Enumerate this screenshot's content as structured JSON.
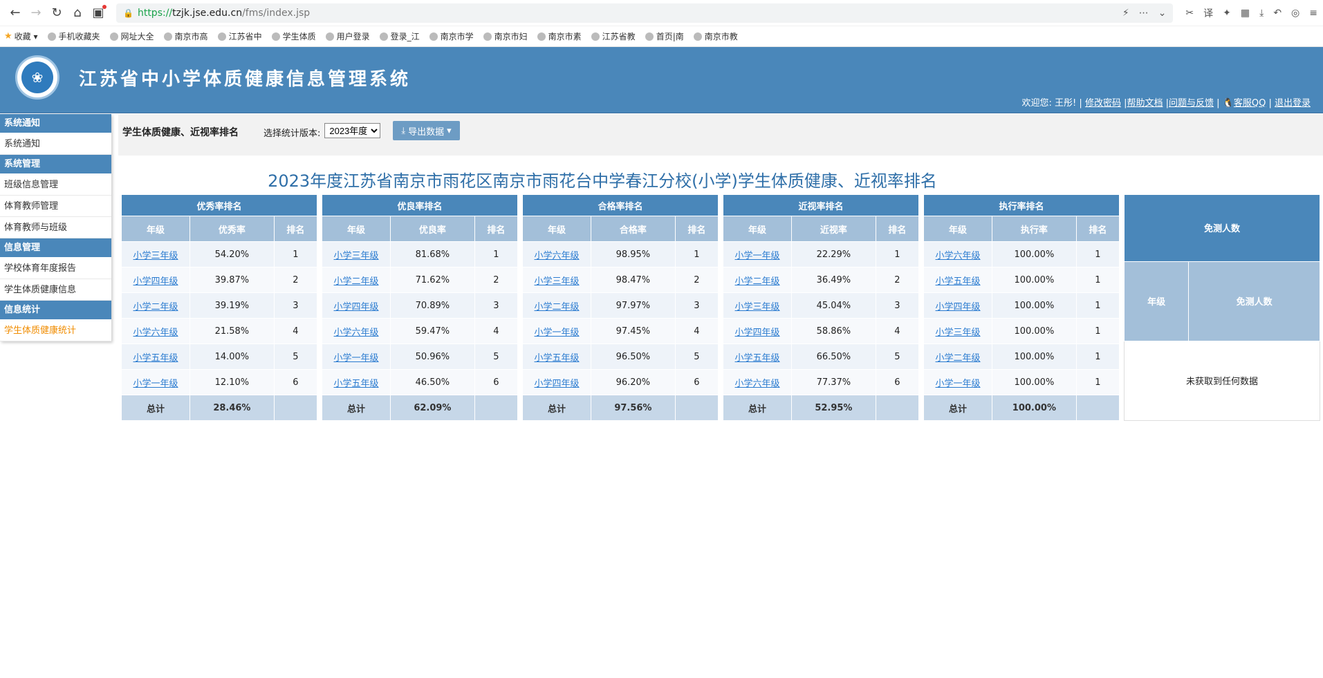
{
  "browser": {
    "url_https": "https://",
    "url_host": "tzjk.jse.edu.cn",
    "url_path": "/fms/index.jsp",
    "bookmarks": [
      "收藏",
      "手机收藏夹",
      "网址大全",
      "南京市高",
      "江苏省中",
      "学生体质",
      "用户登录",
      "登录_江",
      "南京市学",
      "南京市妇",
      "南京市素",
      "江苏省教",
      "首页|南",
      "南京市教"
    ]
  },
  "header": {
    "title": "江苏省中小学体质健康信息管理系统",
    "welcome": "欢迎您: 王彤! |",
    "links": [
      "修改密码",
      "帮助文档",
      "问题与反馈",
      "客服QQ",
      "退出登录"
    ]
  },
  "sidebar": {
    "sec1": "系统通知",
    "item1": "系统通知",
    "sec2": "系统管理",
    "item2": "班级信息管理",
    "item3": "体育教师管理",
    "item4": "体育教师与班级",
    "sec3": "信息管理",
    "item5": "学校体育年度报告",
    "item6": "学生体质健康信息",
    "sec4": "信息统计",
    "item7": "学生体质健康统计"
  },
  "toolbar": {
    "page_label": "学生体质健康、近视率排名",
    "version_label": "选择统计版本:",
    "version_value": "2023年度",
    "export_label": "导出数据"
  },
  "main_title": "2023年度江苏省南京市雨花区南京市雨花台中学春江分校(小学)学生体质健康、近视率排名",
  "col_grade": "年级",
  "col_rank": "排名",
  "total_label": "总计",
  "tables": [
    {
      "title": "优秀率排名",
      "metric": "优秀率",
      "rows": [
        [
          "小学三年级",
          "54.20%",
          "1"
        ],
        [
          "小学四年级",
          "39.87%",
          "2"
        ],
        [
          "小学二年级",
          "39.19%",
          "3"
        ],
        [
          "小学六年级",
          "21.58%",
          "4"
        ],
        [
          "小学五年级",
          "14.00%",
          "5"
        ],
        [
          "小学一年级",
          "12.10%",
          "6"
        ]
      ],
      "total": "28.46%"
    },
    {
      "title": "优良率排名",
      "metric": "优良率",
      "rows": [
        [
          "小学三年级",
          "81.68%",
          "1"
        ],
        [
          "小学二年级",
          "71.62%",
          "2"
        ],
        [
          "小学四年级",
          "70.89%",
          "3"
        ],
        [
          "小学六年级",
          "59.47%",
          "4"
        ],
        [
          "小学一年级",
          "50.96%",
          "5"
        ],
        [
          "小学五年级",
          "46.50%",
          "6"
        ]
      ],
      "total": "62.09%"
    },
    {
      "title": "合格率排名",
      "metric": "合格率",
      "rows": [
        [
          "小学六年级",
          "98.95%",
          "1"
        ],
        [
          "小学三年级",
          "98.47%",
          "2"
        ],
        [
          "小学二年级",
          "97.97%",
          "3"
        ],
        [
          "小学一年级",
          "97.45%",
          "4"
        ],
        [
          "小学五年级",
          "96.50%",
          "5"
        ],
        [
          "小学四年级",
          "96.20%",
          "6"
        ]
      ],
      "total": "97.56%"
    },
    {
      "title": "近视率排名",
      "metric": "近视率",
      "rows": [
        [
          "小学一年级",
          "22.29%",
          "1"
        ],
        [
          "小学二年级",
          "36.49%",
          "2"
        ],
        [
          "小学三年级",
          "45.04%",
          "3"
        ],
        [
          "小学四年级",
          "58.86%",
          "4"
        ],
        [
          "小学五年级",
          "66.50%",
          "5"
        ],
        [
          "小学六年级",
          "77.37%",
          "6"
        ]
      ],
      "total": "52.95%"
    },
    {
      "title": "执行率排名",
      "metric": "执行率",
      "rows": [
        [
          "小学六年级",
          "100.00%",
          "1"
        ],
        [
          "小学五年级",
          "100.00%",
          "1"
        ],
        [
          "小学四年级",
          "100.00%",
          "1"
        ],
        [
          "小学三年级",
          "100.00%",
          "1"
        ],
        [
          "小学二年级",
          "100.00%",
          "1"
        ],
        [
          "小学一年级",
          "100.00%",
          "1"
        ]
      ],
      "total": "100.00%"
    }
  ],
  "exempt": {
    "title": "免测人数",
    "col_grade": "年级",
    "col_count": "免测人数",
    "empty": "未获取到任何数据"
  }
}
